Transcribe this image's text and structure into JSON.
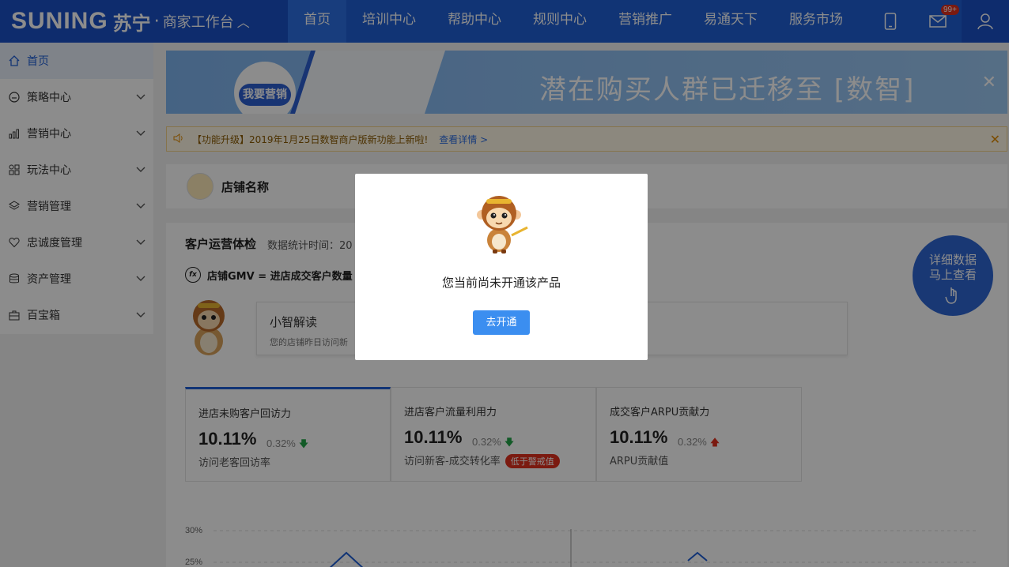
{
  "header": {
    "logo_text": "SUNING",
    "logo_cn": "苏宁",
    "logo_dot": "·",
    "workspace": "商家工作台",
    "workspace_caret": "︿",
    "nav": [
      {
        "label": "首页",
        "active": true
      },
      {
        "label": "培训中心"
      },
      {
        "label": "帮助中心"
      },
      {
        "label": "规则中心"
      },
      {
        "label": "营销推广"
      },
      {
        "label": "易通天下"
      },
      {
        "label": "服务市场"
      }
    ],
    "icons": {
      "mobile": "mobile-icon",
      "mail": "mail-icon",
      "user": "user-icon"
    },
    "mail_badge": "99+"
  },
  "sidebar": {
    "items": [
      {
        "label": "首页",
        "icon": "home-icon"
      },
      {
        "label": "策略中心",
        "icon": "strategy-icon"
      },
      {
        "label": "营销中心",
        "icon": "bar-chart-icon"
      },
      {
        "label": "玩法中心",
        "icon": "grid-icon"
      },
      {
        "label": "营销管理",
        "icon": "layers-icon"
      },
      {
        "label": "忠诚度管理",
        "icon": "heart-icon"
      },
      {
        "label": "资产管理",
        "icon": "database-icon"
      },
      {
        "label": "百宝箱",
        "icon": "toolbox-icon"
      }
    ]
  },
  "banner": {
    "button": "我要营销",
    "headline": "潜在购买人群已迁移至 [数智]",
    "close": "✕"
  },
  "notice": {
    "text": "【功能升级】2019年1月25日数智商户版新功能上新啦!",
    "link": "查看详情 >",
    "close": "✕"
  },
  "shop": {
    "name": "店铺名称"
  },
  "health": {
    "title": "客户运营体检",
    "stat_time": "数据统计时间：20",
    "formula": "店铺GMV = 进店成交客户数量",
    "fx": "fx",
    "insight_title": "小智解读",
    "insight_text": "您的店铺昨日访问新"
  },
  "kpis": [
    {
      "title": "进店未购客户回访力",
      "value": "10.11%",
      "delta": "0.32%",
      "direction": "down",
      "label": "访问老客回访率"
    },
    {
      "title": "进店客户流量利用力",
      "value": "10.11%",
      "delta": "0.32%",
      "direction": "down",
      "label": "访问新客-成交转化率",
      "warning": "低于警戒值"
    },
    {
      "title": "成交客户ARPU贡献力",
      "value": "10.11%",
      "delta": "0.32%",
      "direction": "up",
      "label": "ARPU贡献值"
    }
  ],
  "chart": {
    "ticks": [
      "30%",
      "25%"
    ]
  },
  "float_button": {
    "line1": "详细数据",
    "line2": "马上查看"
  },
  "modal": {
    "message": "您当前尚未开通该产品",
    "button": "去开通"
  },
  "colors": {
    "brand": "#1f5fd6",
    "primary_button": "#3b8ef0",
    "warning": "#e0301e",
    "up": "#e0301e",
    "down": "#22a447"
  }
}
